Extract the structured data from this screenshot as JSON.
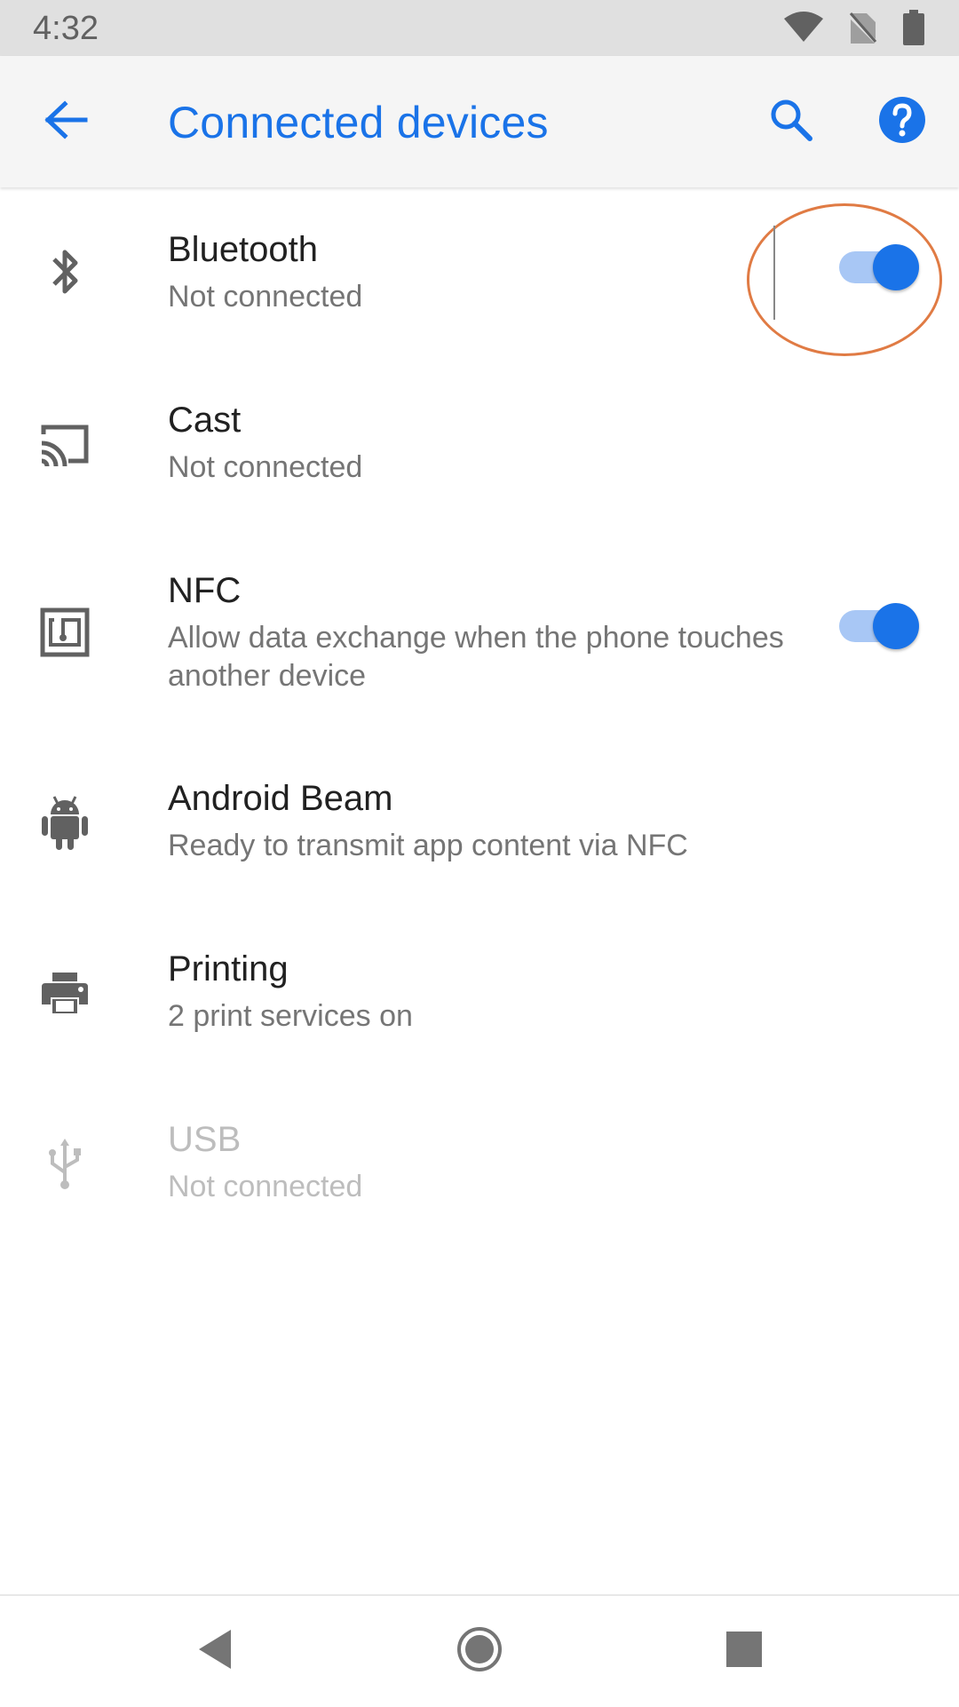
{
  "status_bar": {
    "time": "4:32",
    "icons": [
      "wifi-icon",
      "no-sim-icon",
      "battery-icon"
    ]
  },
  "toolbar": {
    "title": "Connected devices",
    "back_icon": "arrow-back-icon",
    "search_icon": "search-icon",
    "help_icon": "help-icon"
  },
  "items": [
    {
      "title": "Bluetooth",
      "subtitle": "Not connected",
      "icon": "bluetooth-icon",
      "toggle": true,
      "enabled": true
    },
    {
      "title": "Cast",
      "subtitle": "Not connected",
      "icon": "cast-icon",
      "enabled": true
    },
    {
      "title": "NFC",
      "subtitle": "Allow data exchange when the phone touches another device",
      "icon": "nfc-icon",
      "toggle": true,
      "enabled": true
    },
    {
      "title": "Android Beam",
      "subtitle": "Ready to transmit app content via NFC",
      "icon": "android-icon",
      "enabled": true
    },
    {
      "title": "Printing",
      "subtitle": "2 print services on",
      "icon": "print-icon",
      "enabled": true
    },
    {
      "title": "USB",
      "subtitle": "Not connected",
      "icon": "usb-icon",
      "enabled": false
    }
  ],
  "nav_bar": {
    "icons": [
      "back-triangle-icon",
      "home-circle-icon",
      "recents-square-icon"
    ]
  },
  "colors": {
    "accent": "#1a73e8",
    "annotation": "#e07b44",
    "toolbar_bg": "#f5f5f5",
    "status_bg": "#e0e0e0"
  }
}
